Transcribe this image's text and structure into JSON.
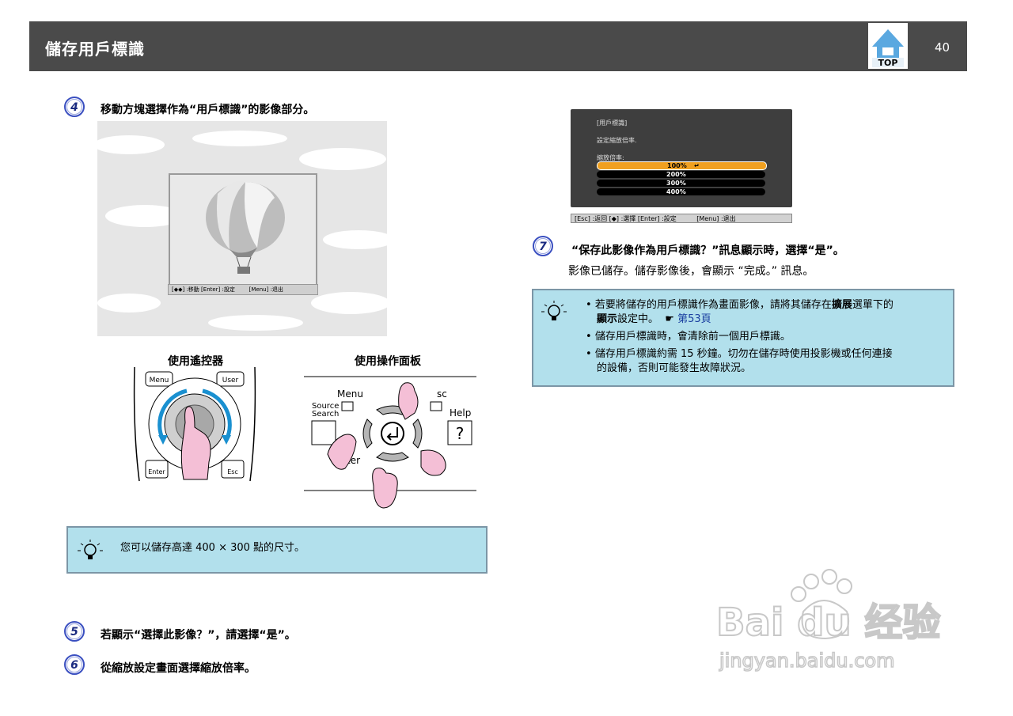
{
  "header": {
    "title": "儲存用戶標識",
    "page_number": "40",
    "top_label": "TOP"
  },
  "steps": {
    "s4": {
      "num": "4",
      "text": "移動方塊選擇作為“用戶標識”的影像部分。"
    },
    "s5": {
      "num": "5",
      "text": "若顯示“選擇此影像？”，請選擇“是”。"
    },
    "s6": {
      "num": "6",
      "text": "從縮放設定畫面選擇縮放倍率。"
    },
    "s7": {
      "num": "7",
      "text": "“保存此影像作為用戶標識？”訊息顯示時，選擇“是”。",
      "body": "影像已儲存。儲存影像後，會顯示 “完成。” 訊息。"
    }
  },
  "sky_image": {
    "status": "[◆◆] :移動 [Enter] :設定        [Menu] :退出"
  },
  "remote": {
    "caption": "使用遙控器",
    "buttons": {
      "menu": "Menu",
      "user": "User",
      "enter": "Enter",
      "esc": "Esc"
    }
  },
  "panel": {
    "caption": "使用操作面板",
    "labels": {
      "menu": "Menu",
      "source": "Source",
      "search": "Search",
      "esc": "sc",
      "help": "Help",
      "q": "?",
      "ter": "ter"
    }
  },
  "note_left": {
    "text": "您可以儲存高達 400 × 300 點的尺寸。"
  },
  "menu_screen": {
    "title": "[用戶標識]",
    "line1": "設定縮放倍率.",
    "line2": "縮放倍率:",
    "options": [
      "100%",
      "200%",
      "300%",
      "400%"
    ],
    "status": "[Esc] :返回 [◆] :選擇 [Enter] :設定          [Menu] :退出"
  },
  "note_right": {
    "b1_pre": "若要將儲存的用戶標識作為畫面影像，請將其儲存在",
    "b1_bold1": "擴展",
    "b1_mid": "選單下的",
    "b1_bold2": "顯示",
    "b1_post": "設定中。",
    "b1_link": "第53頁",
    "b2": "儲存用戶標識時，會清除前一個用戶標識。",
    "b3_l1": "儲存用戶標識約需 15 秒鐘。切勿在儲存時使用投影機或任何連接",
    "b3_l2": "的設備，否則可能發生故障狀況。"
  },
  "watermark": {
    "brand": "Bai du 经验",
    "url": "jingyan.baidu.com"
  },
  "colors": {
    "header_bg": "#4a4a4a",
    "note_bg": "#b2e0ec",
    "step_blue": "#3a4fc0",
    "highlight": "#f0a020"
  }
}
